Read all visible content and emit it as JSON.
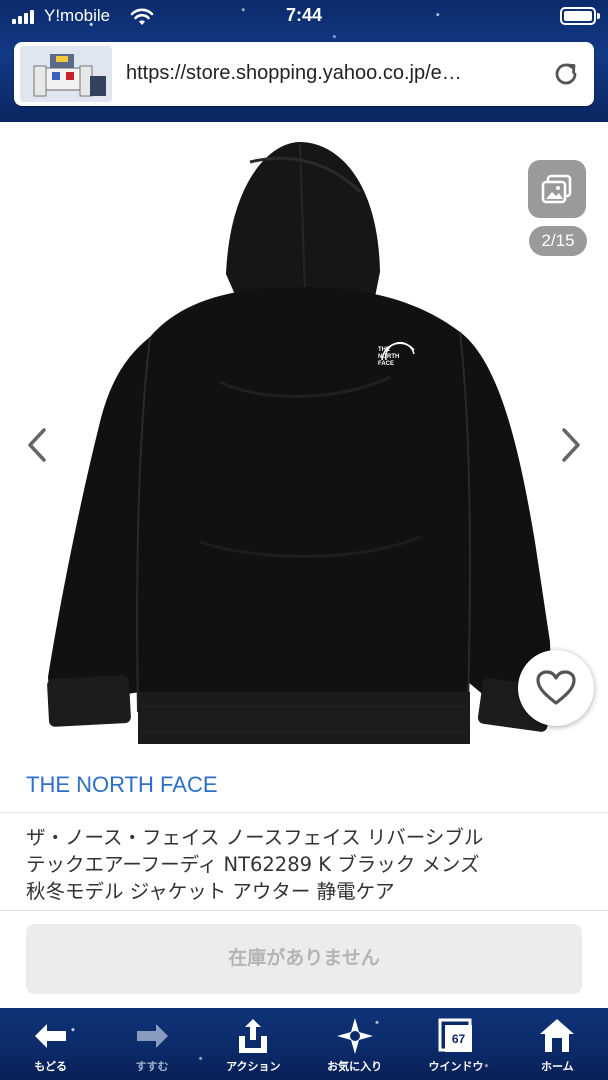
{
  "status_bar": {
    "carrier": "Y!mobile",
    "time": "7:44"
  },
  "browser": {
    "url": "https://store.shopping.yahoo.co.jp/e…",
    "reload_icon": "reload-icon",
    "site_icon": "site-thumbnail-icon"
  },
  "gallery": {
    "counter": "2/15",
    "gallery_icon": "image-gallery-icon",
    "prev_icon": "chevron-left-icon",
    "next_icon": "chevron-right-icon",
    "favorite_icon": "heart-icon",
    "jacket_logo": "THE NORTH FACE"
  },
  "product": {
    "brand": "THE NORTH FACE",
    "title_line1": "ザ・ノース・フェイス ノースフェイス リバーシブル",
    "title_line2": "テックエアーフーディ NT62289 K ブラック メンズ",
    "title_line3": "秋冬モデル ジャケット アウター 静電ケア",
    "stock_label": "在庫がありません"
  },
  "toolbar": {
    "items": [
      {
        "label": "もどる",
        "icon": "back-arrow-icon"
      },
      {
        "label": "すすむ",
        "icon": "forward-arrow-icon"
      },
      {
        "label": "アクション",
        "icon": "share-icon"
      },
      {
        "label": "お気に入り",
        "icon": "bookmark-star-icon"
      },
      {
        "label": "ウインドウ",
        "icon": "windows-icon",
        "badge": "67"
      },
      {
        "label": "ホーム",
        "icon": "home-icon"
      }
    ]
  }
}
